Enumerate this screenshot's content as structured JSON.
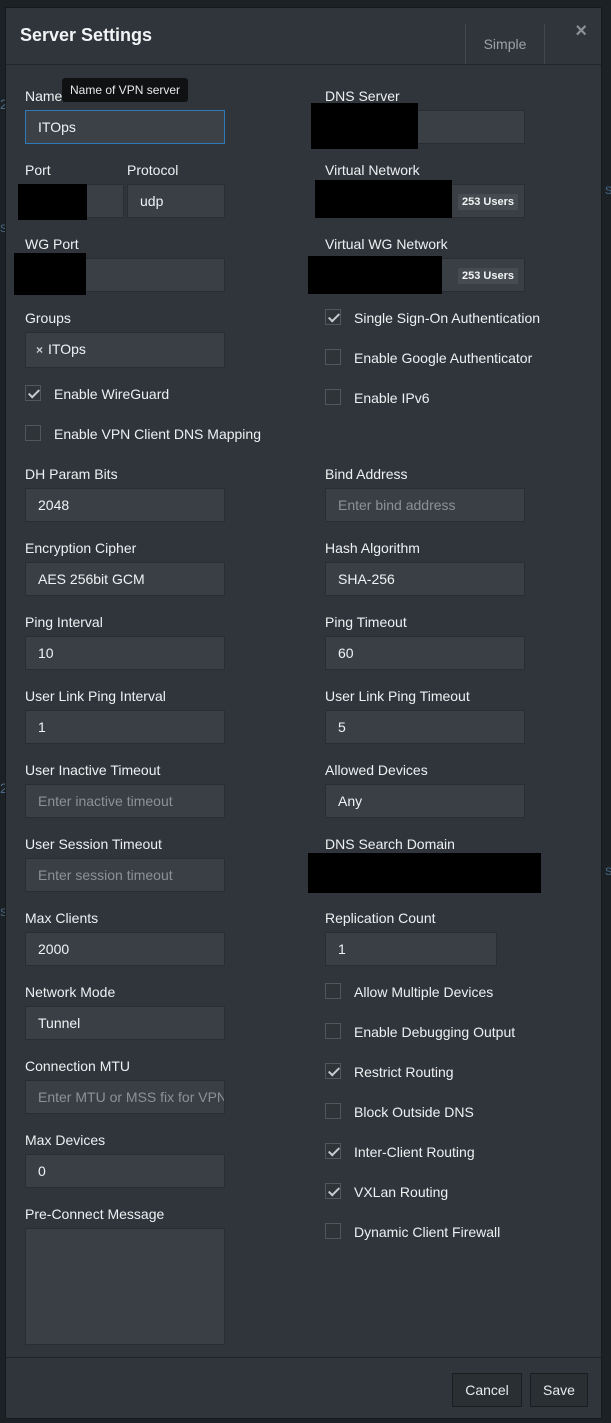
{
  "background": {
    "fragments": [
      "2",
      "S",
      "S",
      "2",
      "S",
      "S"
    ]
  },
  "header": {
    "title": "Server Settings",
    "mode_button": "Simple",
    "close_glyph": "×"
  },
  "tooltip": "Name of VPN server",
  "fields": {
    "name": {
      "label": "Name",
      "value": "ITOps"
    },
    "dns_server": {
      "label": "DNS Server"
    },
    "port": {
      "label": "Port"
    },
    "protocol": {
      "label": "Protocol",
      "value": "udp"
    },
    "virtual_network": {
      "label": "Virtual Network",
      "badge": "253 Users"
    },
    "wg_port": {
      "label": "WG Port"
    },
    "virtual_wg_network": {
      "label": "Virtual WG Network",
      "badge": "253 Users"
    },
    "groups": {
      "label": "Groups",
      "tag": "ITOps",
      "tag_remove": "×"
    },
    "dh_param_bits": {
      "label": "DH Param Bits",
      "value": "2048"
    },
    "bind_address": {
      "label": "Bind Address",
      "placeholder": "Enter bind address"
    },
    "encryption_cipher": {
      "label": "Encryption Cipher",
      "value": "AES 256bit GCM"
    },
    "hash_algorithm": {
      "label": "Hash Algorithm",
      "value": "SHA-256"
    },
    "ping_interval": {
      "label": "Ping Interval",
      "value": "10"
    },
    "ping_timeout": {
      "label": "Ping Timeout",
      "value": "60"
    },
    "user_link_ping_interval": {
      "label": "User Link Ping Interval",
      "value": "1"
    },
    "user_link_ping_timeout": {
      "label": "User Link Ping Timeout",
      "value": "5"
    },
    "user_inactive_timeout": {
      "label": "User Inactive Timeout",
      "placeholder": "Enter inactive timeout"
    },
    "allowed_devices": {
      "label": "Allowed Devices",
      "value": "Any"
    },
    "user_session_timeout": {
      "label": "User Session Timeout",
      "placeholder": "Enter session timeout"
    },
    "dns_search_domain": {
      "label": "DNS Search Domain"
    },
    "max_clients": {
      "label": "Max Clients",
      "value": "2000"
    },
    "replication_count": {
      "label": "Replication Count",
      "value": "1"
    },
    "network_mode": {
      "label": "Network Mode",
      "value": "Tunnel"
    },
    "connection_mtu": {
      "label": "Connection MTU",
      "placeholder": "Enter MTU or MSS fix for VPN"
    },
    "max_devices": {
      "label": "Max Devices",
      "value": "0"
    },
    "pre_connect_message": {
      "label": "Pre-Connect Message",
      "value": ""
    }
  },
  "checkboxes": {
    "enable_wireguard": {
      "label": "Enable WireGuard",
      "checked": true
    },
    "enable_vpn_client_dns_mapping": {
      "label": "Enable VPN Client DNS Mapping",
      "checked": false
    },
    "single_sign_on": {
      "label": "Single Sign-On Authentication",
      "checked": true
    },
    "google_authenticator": {
      "label": "Enable Google Authenticator",
      "checked": false
    },
    "enable_ipv6": {
      "label": "Enable IPv6",
      "checked": false
    },
    "allow_multiple_devices": {
      "label": "Allow Multiple Devices",
      "checked": false
    },
    "enable_debugging_output": {
      "label": "Enable Debugging Output",
      "checked": false
    },
    "restrict_routing": {
      "label": "Restrict Routing",
      "checked": true
    },
    "block_outside_dns": {
      "label": "Block Outside DNS",
      "checked": false
    },
    "inter_client_routing": {
      "label": "Inter-Client Routing",
      "checked": true
    },
    "vxlan_routing": {
      "label": "VXLan Routing",
      "checked": true
    },
    "dynamic_client_firewall": {
      "label": "Dynamic Client Firewall",
      "checked": false
    }
  },
  "footer": {
    "cancel": "Cancel",
    "save": "Save"
  }
}
